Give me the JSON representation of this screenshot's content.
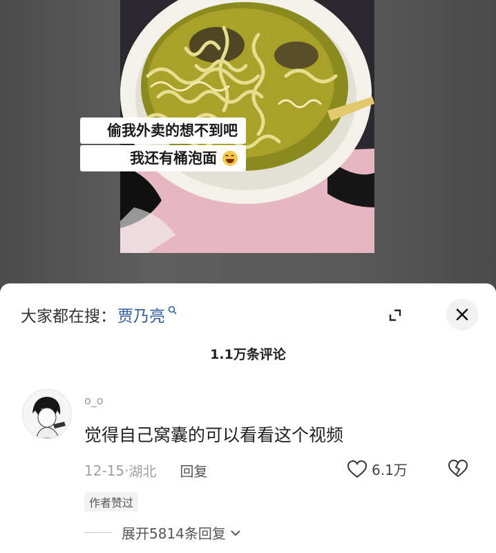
{
  "video": {
    "caption_line1": "偷我外卖的想不到吧",
    "caption_line2": "我还有桶泡面"
  },
  "search_bar": {
    "prefix": "大家都在搜：",
    "term": "贾乃亮"
  },
  "comments_header": {
    "count": "1.1万条评论"
  },
  "comment": {
    "username": "o_o",
    "text": "觉得自己窝囊的可以看看这个视频",
    "date": "12-15",
    "location": "湖北",
    "separator": " · ",
    "reply_label": "回复",
    "like_count": "6.1万",
    "author_badge": "作者赞过",
    "expand_replies_label": "展开5814条回复"
  },
  "colors": {
    "sheet_background": "#ffffff",
    "search_term": "#2f5e9e",
    "backdrop": "#585858"
  }
}
